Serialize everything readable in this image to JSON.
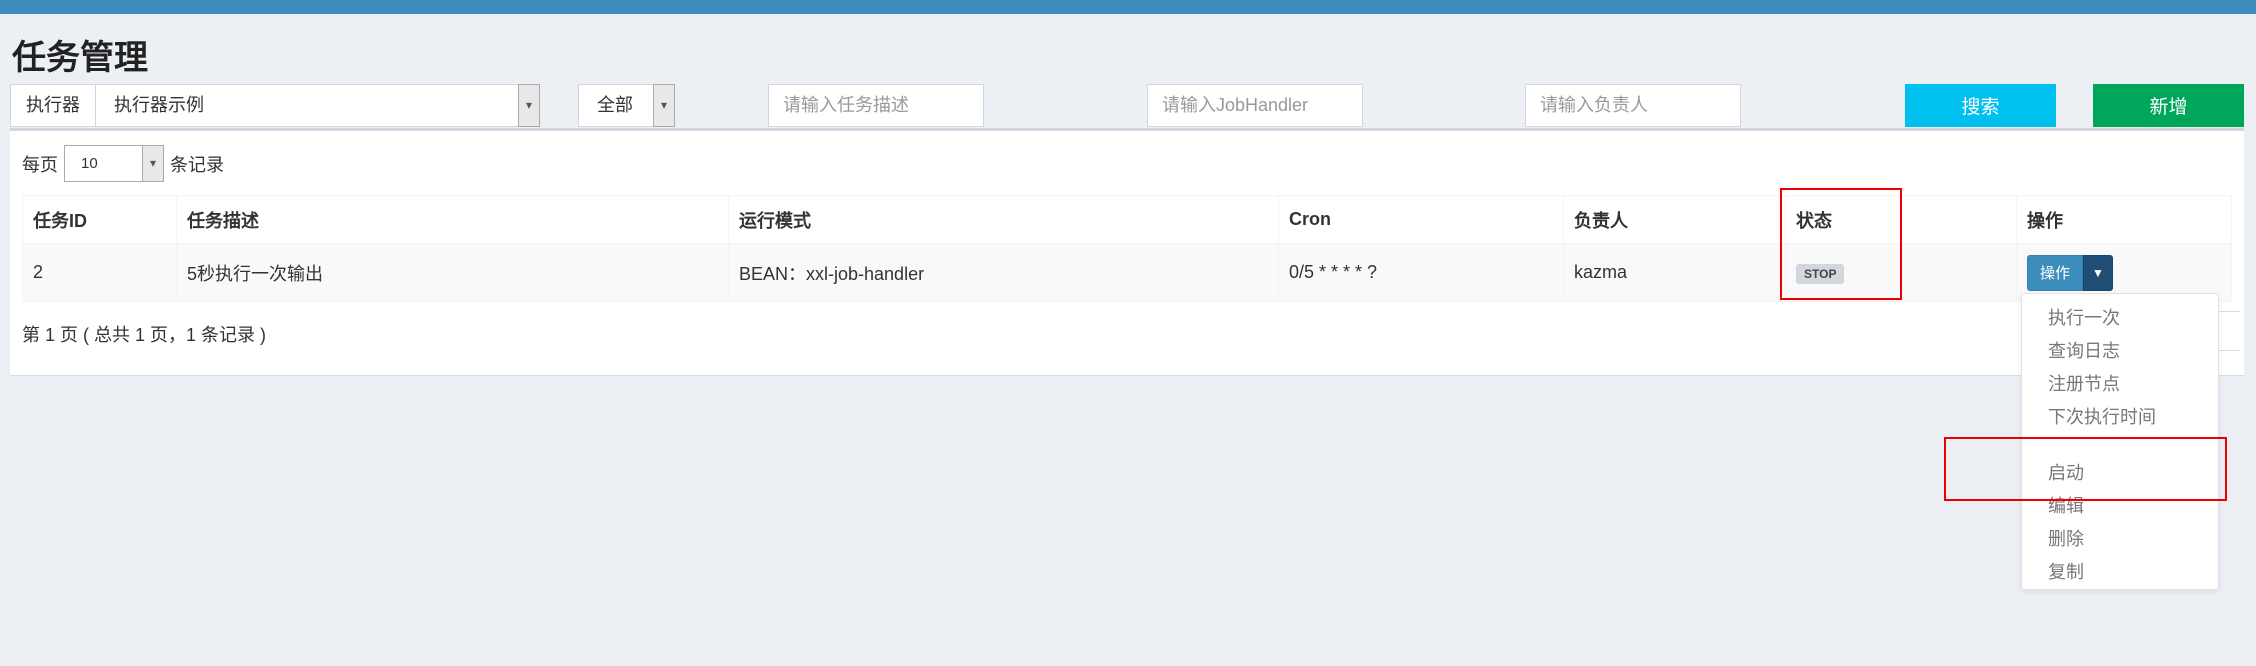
{
  "page": {
    "title": "任务管理"
  },
  "filters": {
    "executor_label": "执行器",
    "executor_value": "执行器示例",
    "status_value": "全部",
    "desc_placeholder": "请输入任务描述",
    "handler_placeholder": "请输入JobHandler",
    "author_placeholder": "请输入负责人",
    "search_label": "搜索",
    "add_label": "新增"
  },
  "table_controls": {
    "per_page_label": "每页",
    "per_page_value": "10",
    "records_label": "条记录"
  },
  "table": {
    "headers": [
      "任务ID",
      "任务描述",
      "运行模式",
      "Cron",
      "负责人",
      "状态",
      "操作"
    ],
    "rows": [
      {
        "id": "2",
        "desc": "5秒执行一次输出",
        "mode": "BEAN：xxl-job-handler",
        "cron": "0/5 * * * * ?",
        "author": "kazma",
        "status": "STOP",
        "op_label": "操作"
      }
    ]
  },
  "pagination": {
    "info": "第 1 页 ( 总共 1 页，1 条记录 )"
  },
  "dropdown": {
    "group1": [
      "执行一次",
      "查询日志",
      "注册节点",
      "下次执行时间"
    ],
    "group2": [
      "启动",
      "编辑",
      "删除",
      "复制"
    ]
  },
  "icons": {
    "select_arrow": "chevron-down-icon",
    "caret": "caret-down-icon"
  },
  "colors": {
    "topbar": "#3c8dbc",
    "search": "#00c0ef",
    "add": "#00a65a",
    "primary": "#3c8dbc",
    "highlight": "#e00000"
  }
}
